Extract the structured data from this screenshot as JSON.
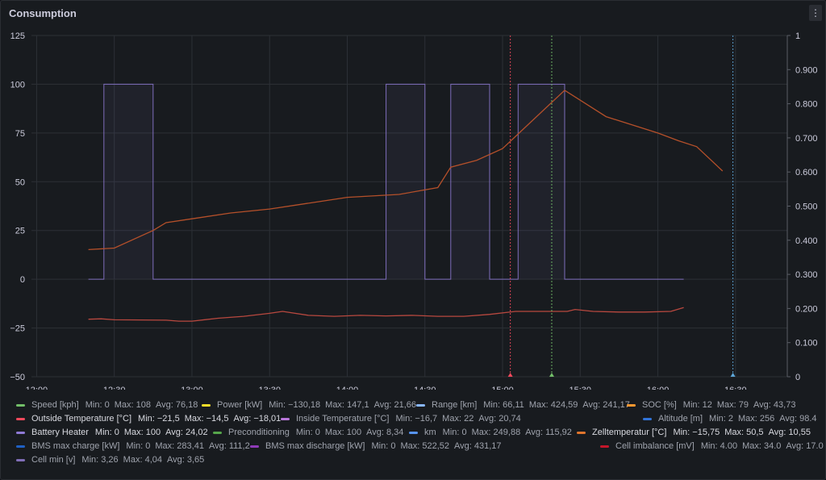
{
  "panel": {
    "title": "Consumption",
    "menu_icon": "⋮"
  },
  "chart_data": {
    "type": "line",
    "title": "Consumption",
    "x_ticks": [
      "12:00",
      "12:30",
      "13:00",
      "13:30",
      "14:00",
      "14:30",
      "15:00",
      "15:30",
      "16:00",
      "16:30"
    ],
    "x_range": [
      "11:58",
      "16:50"
    ],
    "y_left": {
      "min": -50,
      "max": 125,
      "ticks": [
        "125",
        "100",
        "75",
        "50",
        "25",
        "0",
        "−25",
        "−50"
      ]
    },
    "y_right": {
      "min": 0,
      "max": 1,
      "ticks": [
        "1",
        "0.900",
        "0.800",
        "0.700",
        "0.600",
        "0.500",
        "0.400",
        "0.300",
        "0.200",
        "0.100",
        "0"
      ]
    },
    "grid": true,
    "legend_placement": "bottom",
    "series": [
      {
        "name": "Battery Heater",
        "color": "#8f7ad6",
        "axis": "left",
        "style": "step-fill",
        "x": [
          "12:20",
          "12:26",
          "12:26",
          "12:45",
          "12:45",
          "14:15",
          "14:15",
          "14:30",
          "14:30",
          "14:40",
          "14:40",
          "14:55",
          "14:55",
          "15:06",
          "15:06",
          "15:24",
          "15:24",
          "16:10"
        ],
        "values": [
          0,
          0,
          100,
          100,
          0,
          0,
          100,
          100,
          0,
          0,
          100,
          100,
          0,
          0,
          100,
          100,
          0,
          0
        ]
      },
      {
        "name": "Cell imbalance [mV]",
        "color": "#b5502a",
        "axis": "left",
        "style": "line",
        "x": [
          "12:20",
          "12:30",
          "12:45",
          "12:50",
          "13:00",
          "13:15",
          "13:30",
          "13:40",
          "13:50",
          "14:00",
          "14:20",
          "14:35",
          "14:40",
          "14:50",
          "15:00",
          "15:24",
          "15:40",
          "16:00",
          "16:08",
          "16:15",
          "16:25"
        ],
        "values": [
          15.2,
          16,
          25,
          29,
          31,
          34,
          36,
          38,
          40,
          42,
          43.5,
          47,
          57.5,
          61,
          67,
          96.9,
          83.4,
          75,
          71,
          68,
          55.5
        ]
      },
      {
        "name": "Outside Temperature [°C]",
        "color": "#b8483f",
        "axis": "left",
        "style": "line",
        "x": [
          "12:20",
          "12:25",
          "12:30",
          "12:50",
          "12:55",
          "13:00",
          "13:10",
          "13:20",
          "13:30",
          "13:35",
          "13:45",
          "13:55",
          "14:05",
          "14:15",
          "14:25",
          "14:35",
          "14:45",
          "14:55",
          "15:05",
          "15:15",
          "15:25",
          "15:28",
          "15:35",
          "15:45",
          "15:55",
          "16:05",
          "16:10"
        ],
        "values": [
          -20.5,
          -20.3,
          -20.8,
          -21,
          -21.5,
          -21.5,
          -20,
          -19,
          -17.5,
          -16.5,
          -18.5,
          -19,
          -18.5,
          -18.8,
          -18.5,
          -19,
          -19,
          -18,
          -16.5,
          -16.5,
          -16.5,
          -15.5,
          -16.5,
          -16.8,
          -16.8,
          -16.5,
          -14.5
        ]
      }
    ],
    "markers": [
      {
        "time": "15:03",
        "color": "#f2495c"
      },
      {
        "time": "15:19",
        "color": "#73bf69"
      },
      {
        "time": "16:29",
        "color": "#5ea7d9"
      }
    ]
  },
  "legend": [
    {
      "name": "Speed [kph]",
      "color": "#73bf69",
      "min": "0",
      "max": "108",
      "avg": "76,18",
      "bright": false
    },
    {
      "name": "Power [kW]",
      "color": "#fade2a",
      "min": "−130,18",
      "max": "147,1",
      "avg": "21,66",
      "bright": false
    },
    {
      "name": "Range [km]",
      "color": "#8ab8ff",
      "min": "66,11",
      "max": "424,59",
      "avg": "241,17",
      "bright": false
    },
    {
      "name": "SOC [%]",
      "color": "#ff9830",
      "min": "12",
      "max": "79",
      "avg": "43,73",
      "bright": false
    },
    {
      "name": "Outside Temperature [°C]",
      "color": "#f2495c",
      "min": "−21,5",
      "max": "−14,5",
      "avg": "−18,01",
      "bright": true
    },
    {
      "name": "Inside Temperature [°C]",
      "color": "#b877d9",
      "min": "−16,7",
      "max": "22",
      "avg": "20,74",
      "bright": false
    },
    {
      "name": "Altitude [m]",
      "color": "#3274d9",
      "min": "2",
      "max": "256",
      "avg": "98.4",
      "bright": false
    },
    {
      "name": "Battery Heater",
      "color": "#8f7ad6",
      "min": "0",
      "max": "100",
      "avg": "24,02",
      "bright": true
    },
    {
      "name": "Preconditioning",
      "color": "#56a64b",
      "min": "0",
      "max": "100",
      "avg": "8,34",
      "bright": false
    },
    {
      "name": "km",
      "color": "#5794f2",
      "min": "0",
      "max": "249,88",
      "avg": "115,92",
      "bright": false
    },
    {
      "name": "Zelltemperatur [°C]",
      "color": "#e0752d",
      "min": "−15,75",
      "max": "50,5",
      "avg": "10,55",
      "bright": true
    },
    {
      "name": "BMS max charge [kW]",
      "color": "#1f60c4",
      "min": "0",
      "max": "283,41",
      "avg": "111,2",
      "bright": false
    },
    {
      "name": "BMS max discharge [kW]",
      "color": "#8f3bb8",
      "min": "0",
      "max": "522,52",
      "avg": "431,17",
      "bright": false
    },
    {
      "name": "Cell imbalance [mV]",
      "color": "#c4162a",
      "min": "4.00",
      "max": "34.0",
      "avg": "17.0",
      "bright": false
    },
    {
      "name": "Cell min [v]",
      "color": "#806eb7",
      "min": "3,26",
      "max": "4,04",
      "avg": "3,65",
      "bright": false
    }
  ],
  "labels": {
    "min": "Min:",
    "max": "Max:",
    "avg": "Avg:"
  }
}
